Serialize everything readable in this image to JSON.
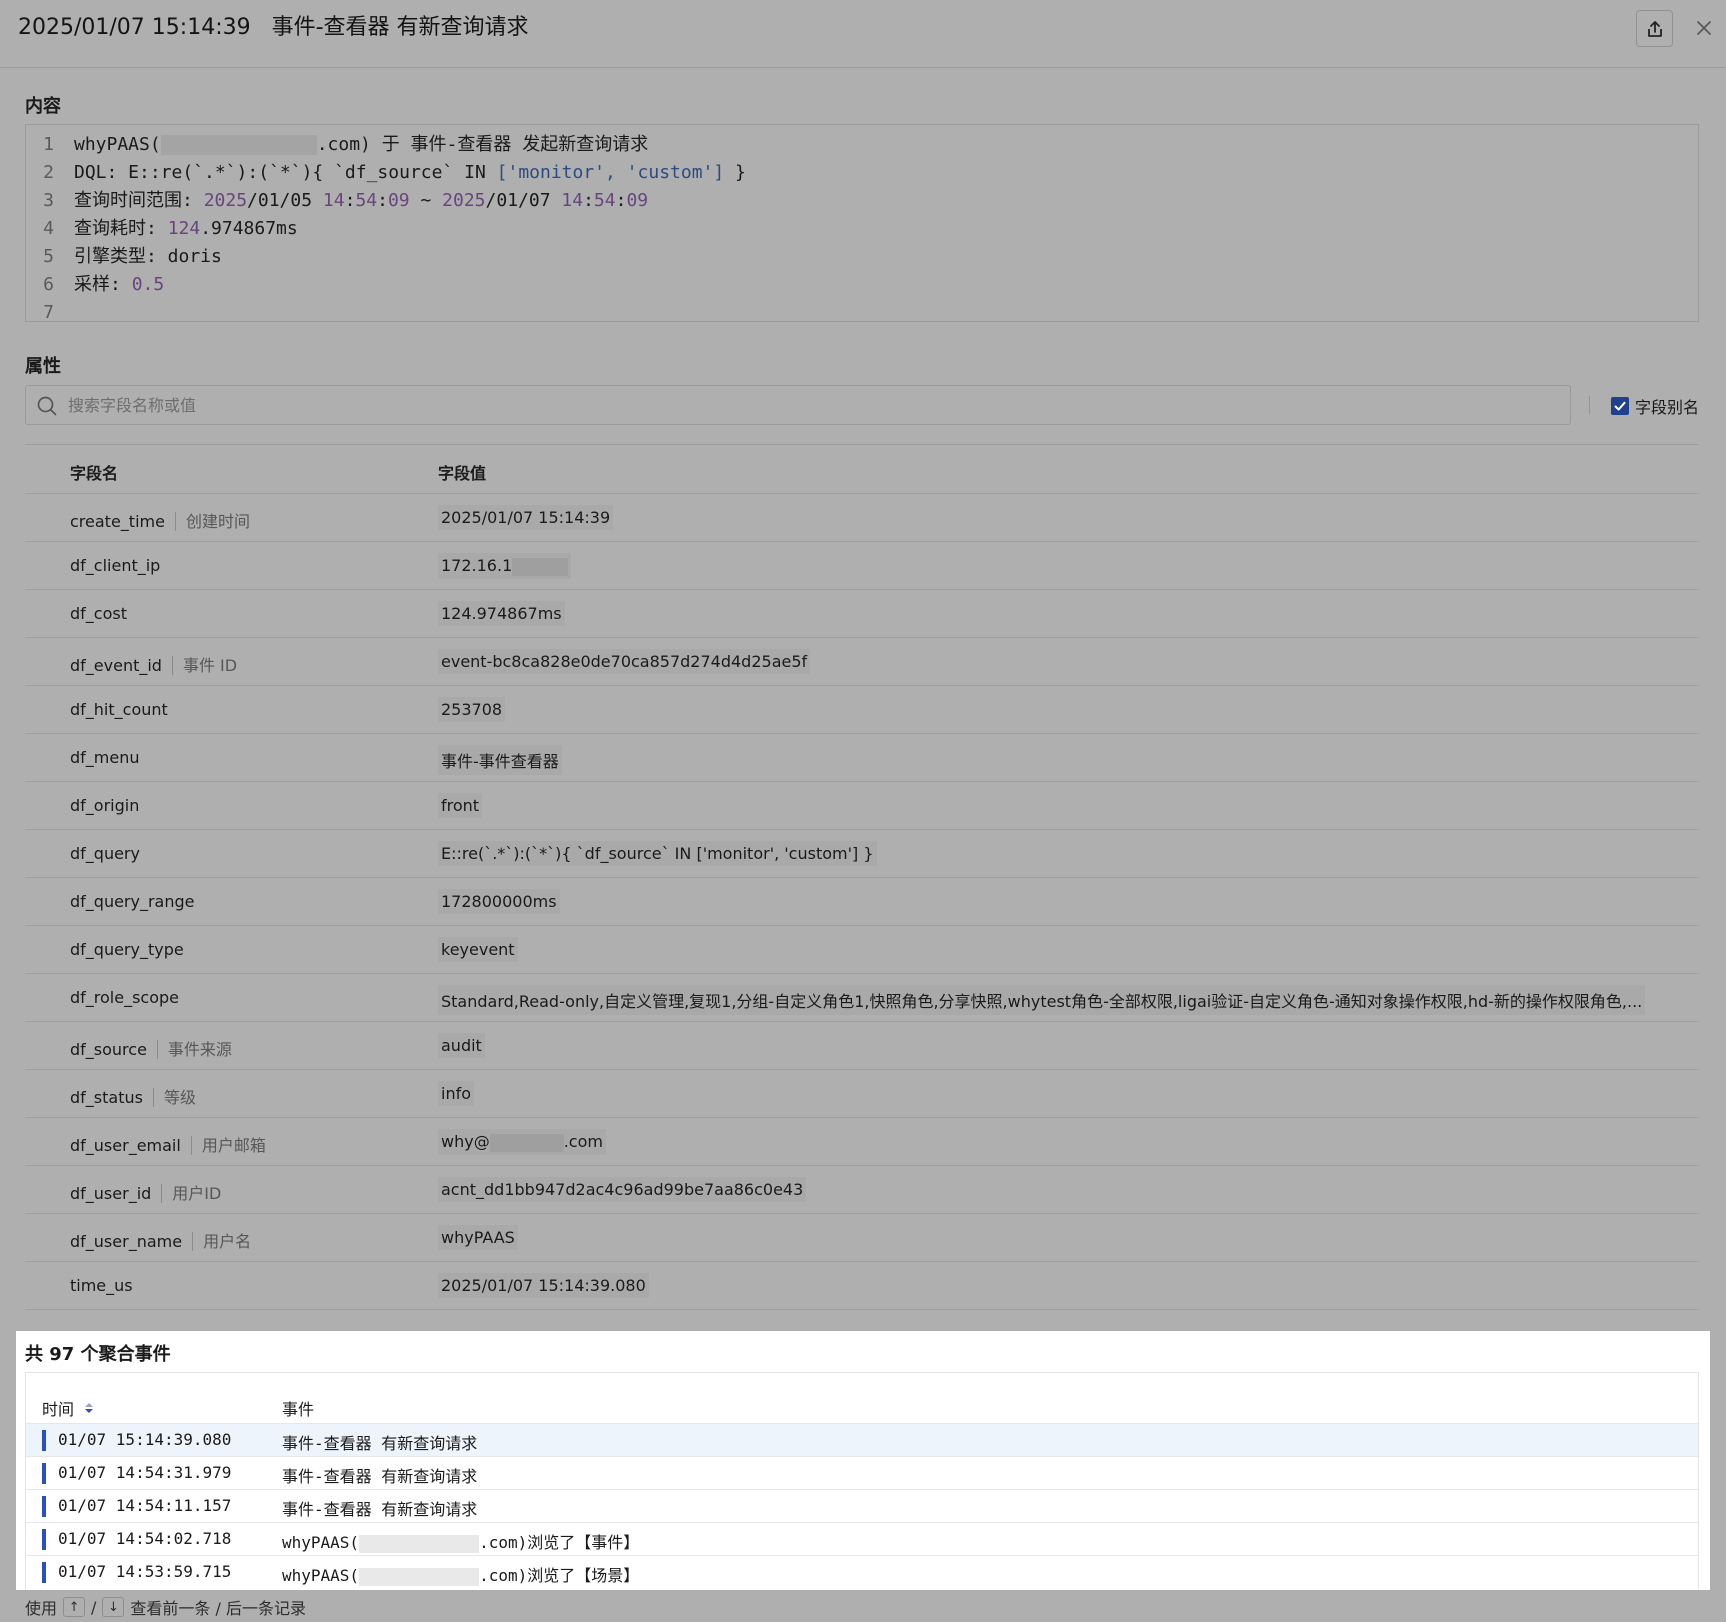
{
  "header": {
    "title": "2025/01/07 15:14:39   事件-查看器 有新查询请求",
    "share_icon": "share-icon",
    "close_icon": "close-icon"
  },
  "content": {
    "label": "内容",
    "lines": [
      {
        "n": "1",
        "parts": [
          {
            "t": "whyPAAS(",
            "c": ""
          },
          {
            "t": "",
            "c": "redact",
            "w": 156
          },
          {
            "t": ".com) 于 事件-查看器 发起新查询请求",
            "c": ""
          }
        ]
      },
      {
        "n": "2",
        "parts": [
          {
            "t": "DQL: E::re(`.*`):(`*`){ `df_source` IN ",
            "c": ""
          },
          {
            "t": "['monitor', 'custom']",
            "c": "str"
          },
          {
            "t": " }",
            "c": ""
          }
        ]
      },
      {
        "n": "3",
        "parts": [
          {
            "t": "查询时间范围: ",
            "c": ""
          },
          {
            "t": "2025",
            "c": "num"
          },
          {
            "t": "/01/05 ",
            "c": ""
          },
          {
            "t": "14",
            "c": "num"
          },
          {
            "t": ":",
            "c": ""
          },
          {
            "t": "54",
            "c": "num"
          },
          {
            "t": ":",
            "c": ""
          },
          {
            "t": "09",
            "c": "num"
          },
          {
            "t": " ~ ",
            "c": ""
          },
          {
            "t": "2025",
            "c": "num"
          },
          {
            "t": "/01/07 ",
            "c": ""
          },
          {
            "t": "14",
            "c": "num"
          },
          {
            "t": ":",
            "c": ""
          },
          {
            "t": "54",
            "c": "num"
          },
          {
            "t": ":",
            "c": ""
          },
          {
            "t": "09",
            "c": "num"
          }
        ]
      },
      {
        "n": "4",
        "parts": [
          {
            "t": "查询耗时: ",
            "c": ""
          },
          {
            "t": "124",
            "c": "num"
          },
          {
            "t": ".974867ms",
            "c": ""
          }
        ]
      },
      {
        "n": "5",
        "parts": [
          {
            "t": "引擎类型: doris",
            "c": ""
          }
        ]
      },
      {
        "n": "6",
        "parts": [
          {
            "t": "采样: ",
            "c": ""
          },
          {
            "t": "0.5",
            "c": "num"
          }
        ]
      },
      {
        "n": "7",
        "parts": []
      }
    ]
  },
  "attributes": {
    "label": "属性",
    "search_placeholder": "搜索字段名称或值",
    "alias_toggle_label": "字段别名",
    "alias_checked": true,
    "col_name": "字段名",
    "col_value": "字段值",
    "rows": [
      {
        "name": "create_time",
        "alias": "创建时间",
        "value": "2025/01/07 15:14:39"
      },
      {
        "name": "df_client_ip",
        "alias": "",
        "value": "172.16.1",
        "redact_after": 80
      },
      {
        "name": "df_cost",
        "alias": "",
        "value": "124.974867ms"
      },
      {
        "name": "df_event_id",
        "alias": "事件 ID",
        "value": "event-bc8ca828e0de70ca857d274d4d25ae5f"
      },
      {
        "name": "df_hit_count",
        "alias": "",
        "value": "253708"
      },
      {
        "name": "df_menu",
        "alias": "",
        "value": "事件-事件查看器"
      },
      {
        "name": "df_origin",
        "alias": "",
        "value": "front"
      },
      {
        "name": "df_query",
        "alias": "",
        "value": "E::re(`.*`):(`*`){ `df_source` IN ['monitor', 'custom'] }"
      },
      {
        "name": "df_query_range",
        "alias": "",
        "value": "172800000ms"
      },
      {
        "name": "df_query_type",
        "alias": "",
        "value": "keyevent"
      },
      {
        "name": "df_role_scope",
        "alias": "",
        "value": "Standard,Read-only,自定义管理,复现1,分组-自定义角色1,快照角色,分享快照,whytest角色-全部权限,ligai验证-自定义角色-通知对象操作权限,hd-新的操作权限角色,..."
      },
      {
        "name": "df_source",
        "alias": "事件来源",
        "value": "audit"
      },
      {
        "name": "df_status",
        "alias": "等级",
        "value": "info"
      },
      {
        "name": "df_user_email",
        "alias": "用户邮箱",
        "value": "why@",
        "redact_mid": 74,
        "value_suffix": ".com"
      },
      {
        "name": "df_user_id",
        "alias": "用户ID",
        "value": "acnt_dd1bb947d2ac4c96ad99be7aa86c0e43"
      },
      {
        "name": "df_user_name",
        "alias": "用户名",
        "value": "whyPAAS"
      },
      {
        "name": "time_us",
        "alias": "",
        "value": "2025/01/07 15:14:39.080"
      }
    ]
  },
  "aggregate": {
    "title": "共 97 个聚合事件",
    "col_time": "时间",
    "col_event": "事件",
    "sort_icon": "sort-icon",
    "rows": [
      {
        "time": "01/07 15:14:39.080",
        "event": "事件-查看器 有新查询请求",
        "selected": true
      },
      {
        "time": "01/07 14:54:31.979",
        "event": "事件-查看器 有新查询请求"
      },
      {
        "time": "01/07 14:54:11.157",
        "event": "事件-查看器 有新查询请求"
      },
      {
        "time": "01/07 14:54:02.718",
        "event_prefix": "whyPAAS(",
        "event_suffix": ".com)浏览了【事件】"
      },
      {
        "time": "01/07 14:53:59.715",
        "event_prefix": "whyPAAS(",
        "event_suffix": ".com)浏览了【场景】"
      }
    ]
  },
  "footer": {
    "prefix": "使用",
    "key_up": "↑",
    "sep": "/",
    "key_down": "↓",
    "suffix": "查看前一条 / 后一条记录"
  }
}
